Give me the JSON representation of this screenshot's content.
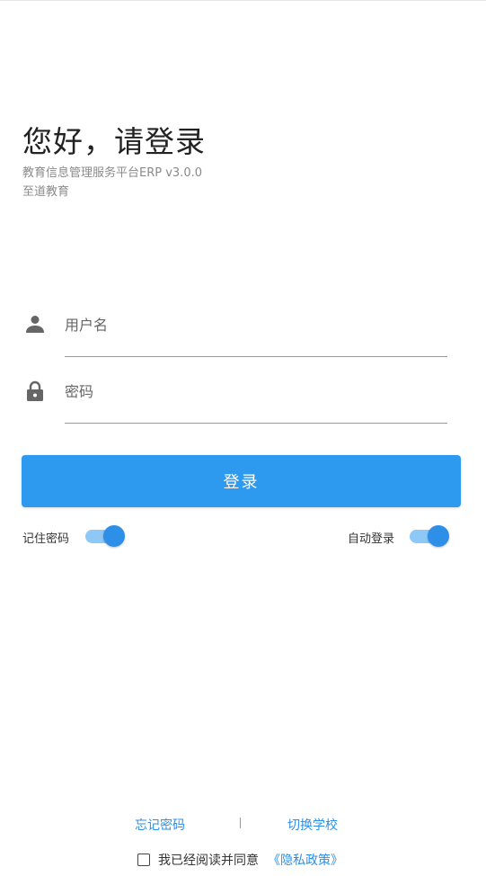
{
  "header": {
    "greeting": "您好，请登录",
    "platform": "教育信息管理服务平台ERP v3.0.0",
    "organization": "至道教育"
  },
  "form": {
    "username_placeholder": "用户名",
    "password_placeholder": "密码",
    "login_label": "登录"
  },
  "options": {
    "remember_label": "记住密码",
    "remember_on": true,
    "auto_login_label": "自动登录",
    "auto_login_on": true
  },
  "footer": {
    "forgot_label": "忘记密码",
    "divider": "|",
    "switch_label": "切换学校",
    "agree_label": "我已经阅读并同意",
    "policy_label": "《隐私政策》",
    "agree_checked": false
  },
  "colors": {
    "accent": "#2d9af0",
    "link": "#2d8fe8",
    "toggle_track": "#8ec8f6"
  },
  "icons": {
    "user": "person-icon",
    "password": "lock-icon"
  }
}
